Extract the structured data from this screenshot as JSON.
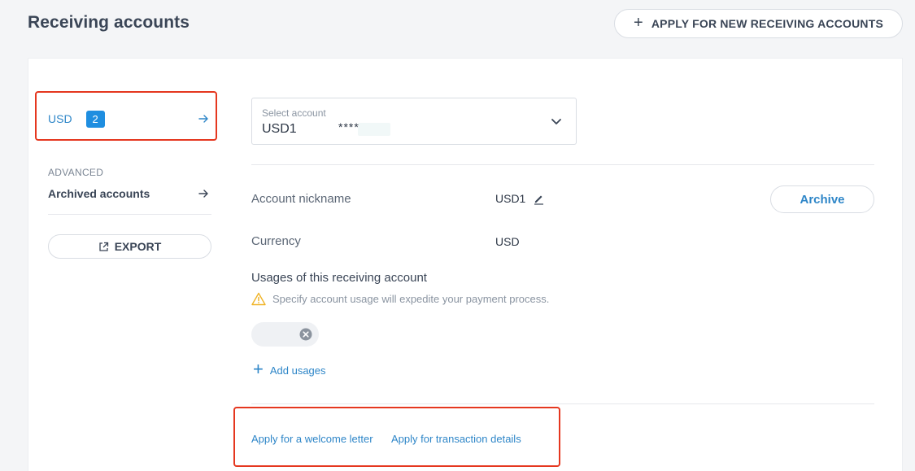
{
  "header": {
    "title": "Receiving accounts",
    "apply_button": "APPLY FOR NEW RECEIVING ACCOUNTS"
  },
  "sidebar": {
    "currency_item": {
      "label": "USD",
      "badge": "2"
    },
    "section_label": "ADVANCED",
    "archived_label": "Archived accounts",
    "export_label": "EXPORT"
  },
  "select": {
    "caption": "Select account",
    "value": "USD1",
    "masked": "****"
  },
  "details": {
    "nickname_label": "Account nickname",
    "nickname_value": "USD1",
    "currency_label": "Currency",
    "currency_value": "USD",
    "archive_button": "Archive"
  },
  "usages": {
    "title": "Usages of this receiving account",
    "hint": "Specify account usage will expedite your payment process.",
    "add_label": "Add usages"
  },
  "links": {
    "welcome_letter": "Apply for a welcome letter",
    "transaction_details": "Apply for transaction details"
  },
  "colors": {
    "accent": "#2e86c8",
    "badge": "#1f8ee0",
    "highlight": "#e5371f",
    "warning": "#f0b429"
  },
  "icons": [
    "plus-icon",
    "arrow-right-icon",
    "external-link-icon",
    "chevron-down-icon",
    "pencil-icon",
    "warning-icon",
    "close-circle-icon"
  ]
}
